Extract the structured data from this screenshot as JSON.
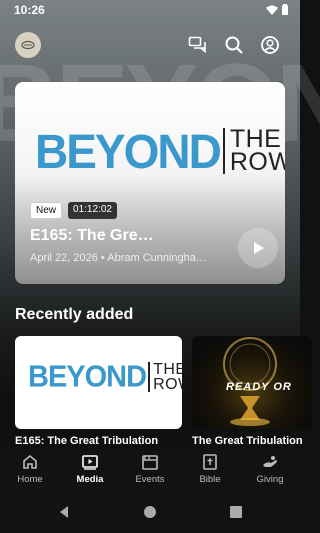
{
  "status": {
    "time": "10:26"
  },
  "background": {
    "watermark": "BEYOND"
  },
  "hero": {
    "logo_word1": "BEYOND",
    "logo_word2a": "THE",
    "logo_word2b": "ROW",
    "badge_new": "New",
    "duration": "01:12:02",
    "title": "E165: The Gre…",
    "meta": "April 22, 2026 • Abram Cunningha…"
  },
  "section": {
    "title": "Recently added"
  },
  "cards": [
    {
      "title": "E165: The Great Tribulation",
      "logo_word1": "BEYOND",
      "logo_word2a": "THE",
      "logo_word2b": "ROW"
    },
    {
      "title": "The Great Tribulation",
      "overlay_text": "READY OR"
    }
  ],
  "nav": [
    {
      "label": "Home",
      "icon": "home-icon",
      "active": false
    },
    {
      "label": "Media",
      "icon": "media-icon",
      "active": true
    },
    {
      "label": "Events",
      "icon": "events-icon",
      "active": false
    },
    {
      "label": "Bible",
      "icon": "bible-icon",
      "active": false
    },
    {
      "label": "Giving",
      "icon": "giving-icon",
      "active": false
    }
  ],
  "colors": {
    "accent": "#3b98cc",
    "background": "#0f1010",
    "nav": "#121212"
  }
}
